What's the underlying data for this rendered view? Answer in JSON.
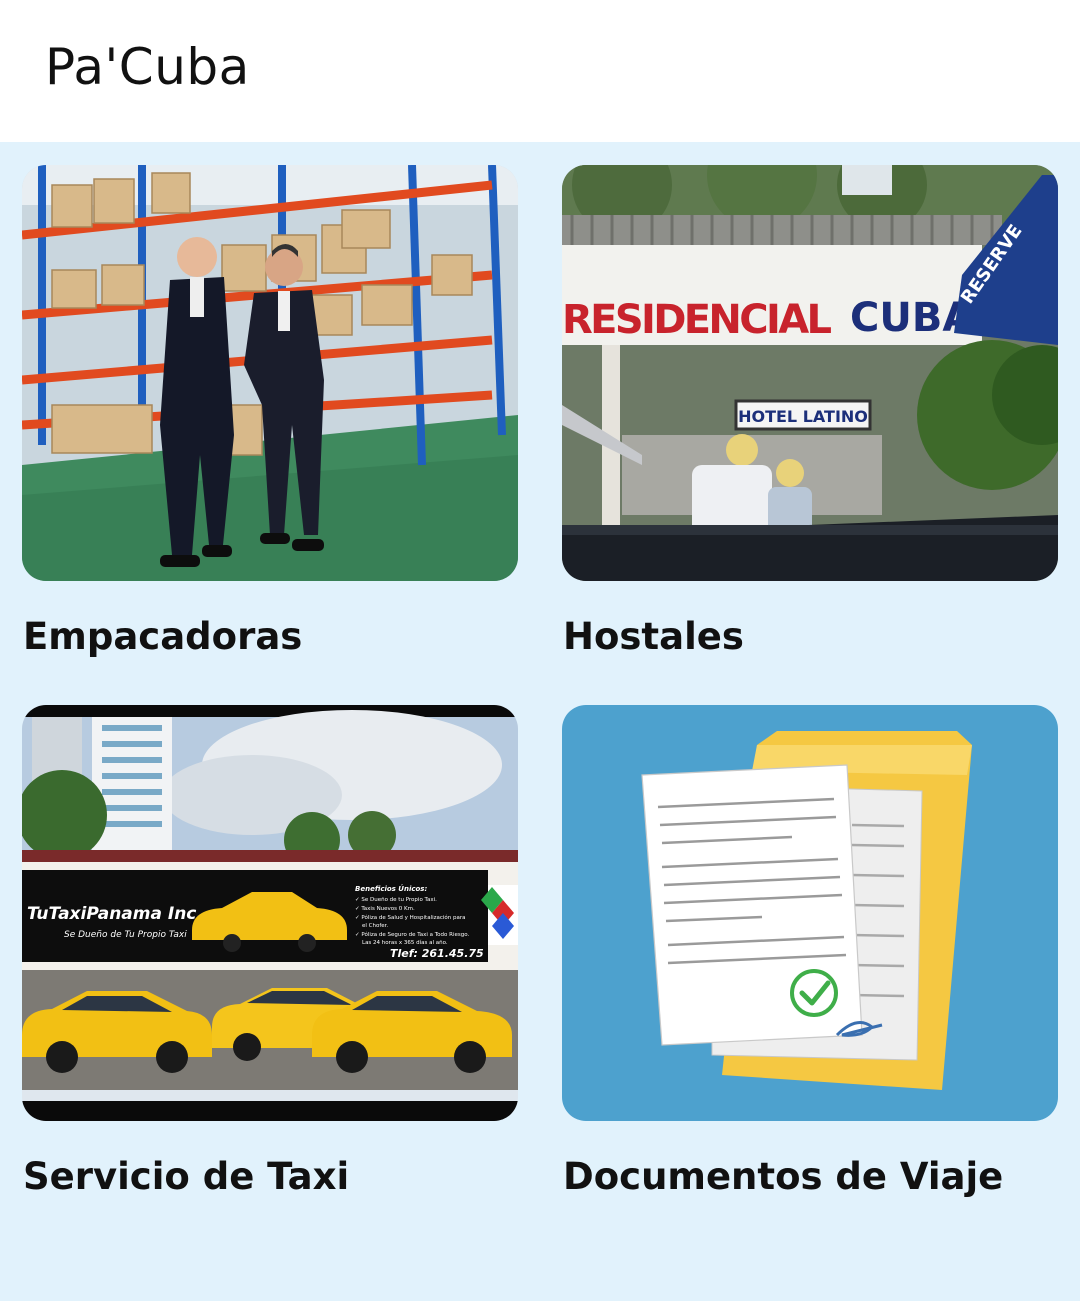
{
  "app": {
    "title": "Pa'Cuba"
  },
  "cards": [
    {
      "label": "Empacadoras"
    },
    {
      "label": "Hostales",
      "sign_text": "RESIDENCIAL CUBA",
      "small_sign_text": "HOTEL LATINO",
      "awning_text": "RESERVE"
    },
    {
      "label": "Servicio de Taxi",
      "billboard": {
        "brand": "TuTaxiPanama Inc.",
        "slogan": "Se Dueño de Tu Propio Taxi",
        "benefits_title": "Beneficios Únicos:",
        "benefits": [
          "✓ Se Dueño de tu Propio Taxi.",
          "✓ Taxis Nuevos 0 Km.",
          "✓ Póliza de Salud y Hospitalización para",
          "el Chofer.",
          "✓ Póliza de Seguro de Taxi a Todo Riesgo.",
          "Las 24 horas x 365 días al año."
        ],
        "phone": "Tlef: 261.45.75"
      }
    },
    {
      "label": "Documentos de Viaje"
    }
  ],
  "colors": {
    "background": "#e1f2fc",
    "appbar": "#ffffff",
    "doc_bg": "#4da1ce",
    "envelope": "#f5c842",
    "check": "#3fae49",
    "taxi_yellow": "#f2c014"
  }
}
